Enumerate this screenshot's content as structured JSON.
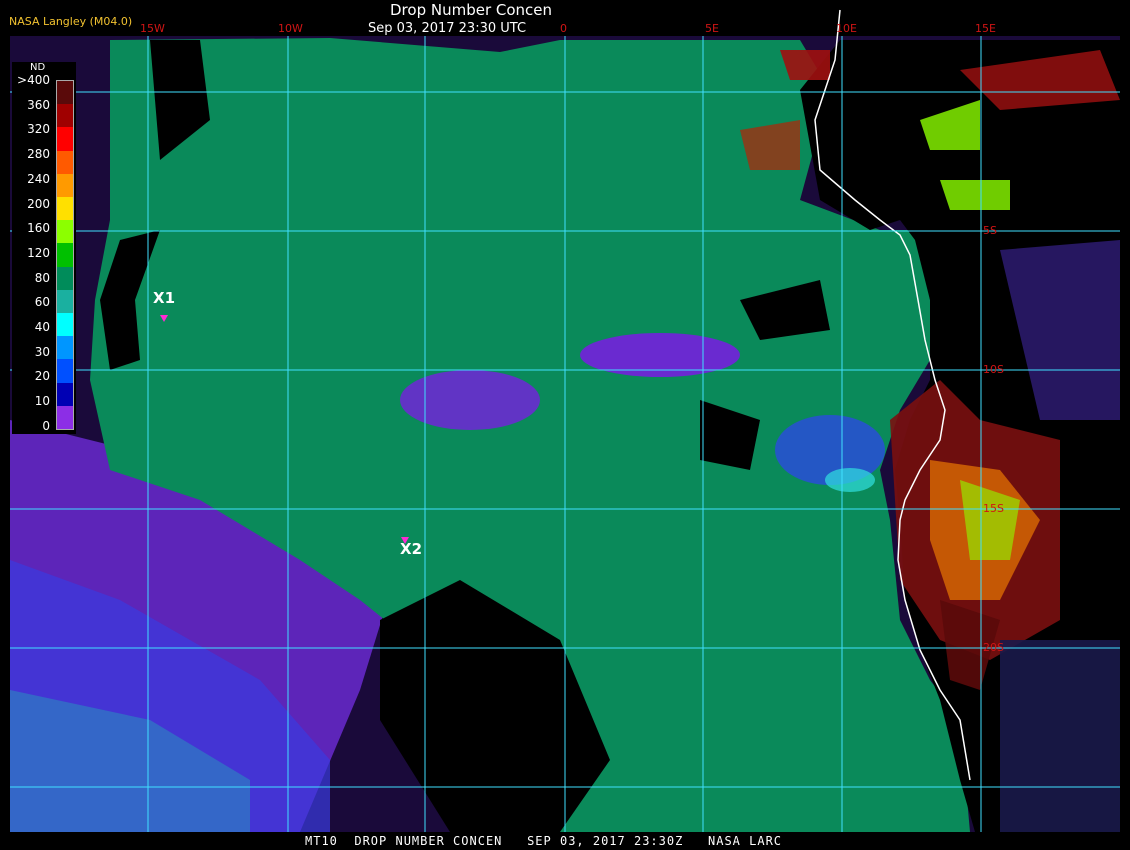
{
  "header": {
    "provider": "NASA Langley (M04.0)",
    "title": "Drop Number Concen",
    "datetime": "Sep 03, 2017 23:30 UTC"
  },
  "longitude_labels": [
    "15W",
    "10W",
    "0",
    "5E",
    "10E",
    "15E"
  ],
  "latitude_labels": [
    "5S",
    "10S",
    "15S",
    "20S"
  ],
  "colorbar": {
    "title": "ND",
    "ticks": [
      ">400",
      "360",
      "320",
      "280",
      "240",
      "200",
      "160",
      "120",
      "80",
      "60",
      "40",
      "30",
      "20",
      "10",
      "0"
    ],
    "colors": [
      "#5a0a0a",
      "#a00000",
      "#ff0000",
      "#ff5a00",
      "#ff9a00",
      "#ffe000",
      "#8cff00",
      "#00c000",
      "#008c5a",
      "#1ab0a0",
      "#00ffff",
      "#0096ff",
      "#0050ff",
      "#0000b4",
      "#8c2ee6"
    ]
  },
  "markers": [
    {
      "label": "X1",
      "color": "#ff2ad4"
    },
    {
      "label": "X2",
      "color": "#ff2ad4"
    }
  ],
  "footer": "MT10  DROP NUMBER CONCEN   SEP 03, 2017 23:30Z   NASA LARC",
  "map_colors": {
    "grid": "#40e0ff",
    "coastline": "#ffffff",
    "land": "#000000"
  }
}
